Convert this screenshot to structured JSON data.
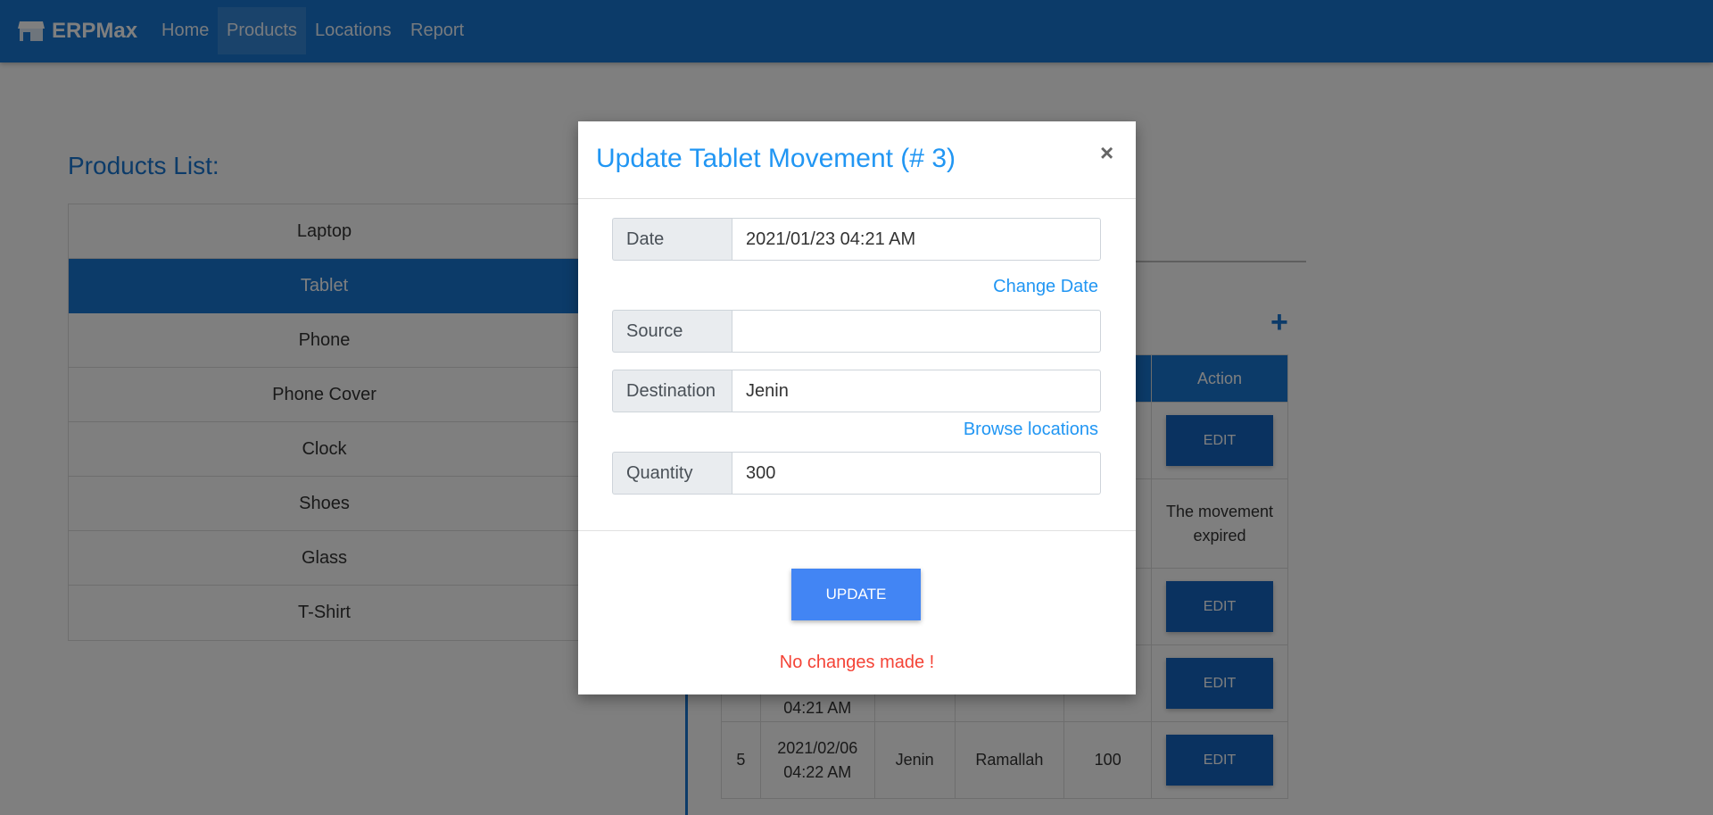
{
  "navbar": {
    "brand": "ERPMax",
    "links": [
      "Home",
      "Products",
      "Locations",
      "Report"
    ],
    "active": "Products",
    "brand_icon": "store-icon"
  },
  "products": {
    "title": "Products List:",
    "items": [
      "Laptop",
      "Tablet",
      "Phone",
      "Phone Cover",
      "Clock",
      "Shoes",
      "Glass",
      "T-Shirt"
    ],
    "selected": "Tablet"
  },
  "movements": {
    "add_icon": "plus-icon",
    "header_action": "Action",
    "rows": [
      {
        "action": "EDIT"
      },
      {
        "action_text": "The movement expired"
      },
      {
        "action": "EDIT"
      },
      {
        "date_partial": "04:21 AM",
        "action": "EDIT"
      },
      {
        "id": "5",
        "date": "2021/02/06 04:22 AM",
        "source": "Jenin",
        "destination": "Ramallah",
        "quantity": "100",
        "action": "EDIT"
      }
    ]
  },
  "modal": {
    "title": "Update Tablet Movement (# 3)",
    "close": "×",
    "date_label": "Date",
    "date_value": "2021/01/23 04:21 AM",
    "change_date": "Change Date",
    "source_label": "Source",
    "source_value": "",
    "destination_label": "Destination",
    "destination_value": "Jenin",
    "browse_locations": "Browse locations",
    "quantity_label": "Quantity",
    "quantity_value": "300",
    "update_button": "UPDATE",
    "message": "No changes made !"
  },
  "colors": {
    "primary": "#1976d2",
    "modal_title": "#2196f3",
    "update_button": "#4285f4",
    "error": "#f44336"
  }
}
